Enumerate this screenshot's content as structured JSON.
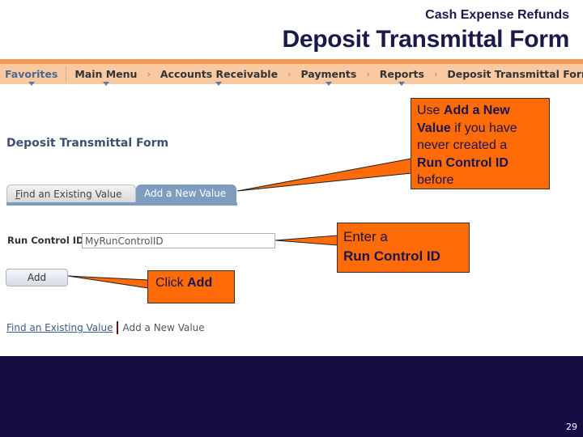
{
  "slide": {
    "subtitle": "Cash Expense Refunds",
    "title": "Deposit Transmittal Form",
    "page_number": "29",
    "colors": {
      "title": "#1a1a4a",
      "nav_background": "#f9c9a2",
      "nav_border": "#f39a55",
      "callout_fill": "#fe6b07",
      "callout_text": "#1c1450",
      "footer_band": "#160d44",
      "active_tab": "#7e9cbd"
    }
  },
  "nav": {
    "favorites": "Favorites",
    "items": [
      {
        "label": "Main Menu",
        "has_dropdown": true
      },
      {
        "label": "Accounts Receivable",
        "has_dropdown": true
      },
      {
        "label": "Payments",
        "has_dropdown": true
      },
      {
        "label": "Reports",
        "has_dropdown": true
      },
      {
        "label": "Deposit Transmittal Form",
        "has_dropdown": false
      }
    ],
    "separator_icon": "chevron-right-icon",
    "separator_glyph": "›"
  },
  "page": {
    "heading": "Deposit Transmittal Form",
    "tabs": [
      {
        "label_underlined_char": "F",
        "label_rest": "ind an Existing Value",
        "active": false
      },
      {
        "label": "Add a New Value",
        "active": true
      }
    ],
    "run_control": {
      "label": "Run Control ID:",
      "value": "MyRunControlID"
    },
    "add_button": "Add",
    "bottom_links": {
      "find": "Find an Existing Value",
      "add": "Add a New Value"
    }
  },
  "callouts": {
    "tab": {
      "t1": "Use ",
      "b1": "Add a New",
      "nl1": "",
      "b2": "Value",
      "t2": " if you have",
      "t3": "never created a",
      "b3": "Run Control ID",
      "t4": "before"
    },
    "input": {
      "t1": "Enter a",
      "b1": "Run Control ID"
    },
    "button": {
      "t1": "Click ",
      "b1": "Add"
    }
  }
}
